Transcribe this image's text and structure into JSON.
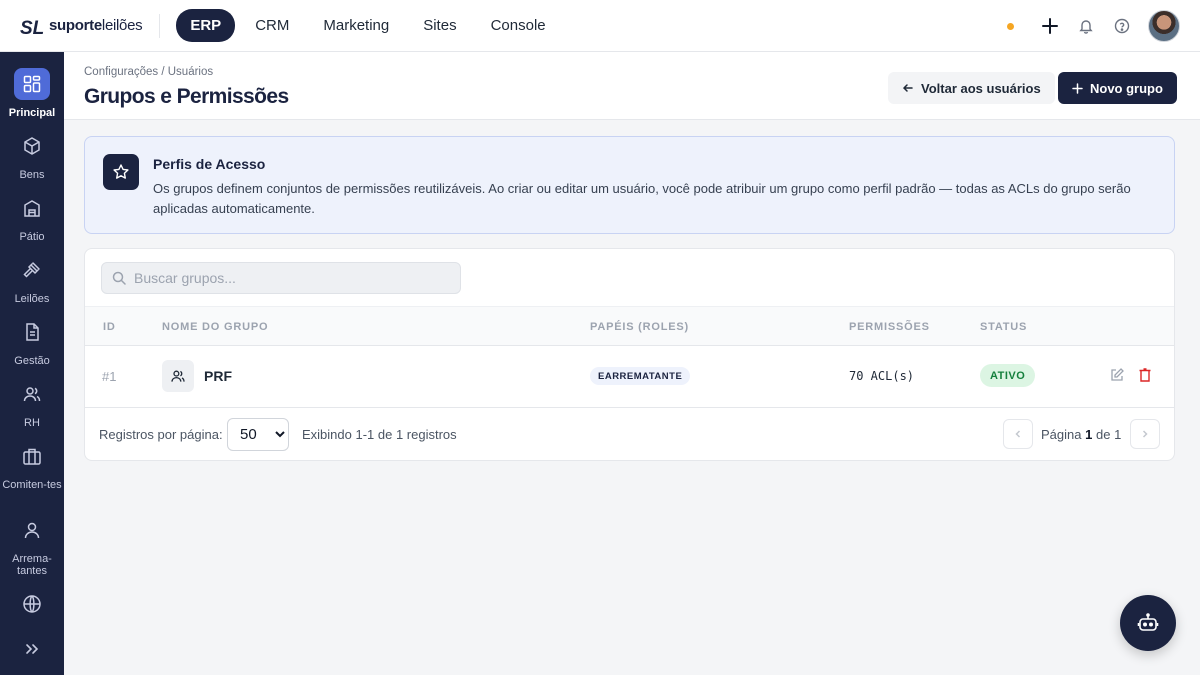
{
  "brand": {
    "name_bold": "suporte",
    "name_light": "leilões"
  },
  "topnav": {
    "items": [
      "ERP",
      "CRM",
      "Marketing",
      "Sites",
      "Console"
    ],
    "active": "ERP"
  },
  "topbar_icons": [
    "status-dot",
    "plus-icon",
    "bell-icon",
    "help-icon",
    "avatar"
  ],
  "sidebar": {
    "items": [
      {
        "label": "Principal",
        "icon": "dashboard-icon",
        "active": true
      },
      {
        "label": "Bens",
        "icon": "box-icon"
      },
      {
        "label": "Pátio",
        "icon": "warehouse-icon"
      },
      {
        "label": "Leilões",
        "icon": "gavel-icon"
      },
      {
        "label": "Gestão",
        "icon": "document-icon"
      },
      {
        "label": "RH",
        "icon": "users-icon"
      },
      {
        "label": "Comiten-tes",
        "icon": "briefcase-icon"
      },
      {
        "label": "Arrema-tantes",
        "icon": "user-icon"
      },
      {
        "label": "",
        "icon": "globe-icon"
      }
    ]
  },
  "header": {
    "breadcrumb": "Configurações / Usuários",
    "title": "Grupos e Permissões",
    "back_label": "Voltar aos usuários",
    "new_label": "Novo grupo"
  },
  "info": {
    "title": "Perfis de Acesso",
    "text": "Os grupos definem conjuntos de permissões reutilizáveis. Ao criar ou editar um usuário, você pode atribuir um grupo como perfil padrão — todas as ACLs do grupo serão aplicadas automaticamente."
  },
  "search": {
    "placeholder": "Buscar grupos..."
  },
  "table": {
    "headers": {
      "id": "ID",
      "name": "NOME DO GRUPO",
      "roles": "PAPÉIS (ROLES)",
      "perms": "PERMISSÕES",
      "status": "STATUS"
    },
    "rows": [
      {
        "id": "#1",
        "name": "PRF",
        "role": "EARREMATANTE",
        "perms": "70 ACL(s)",
        "status": "ATIVO"
      }
    ]
  },
  "footer": {
    "per_page_label": "Registros por página:",
    "per_page_value": "50",
    "showing": "Exibindo 1-1 de 1 registros",
    "page_prefix": "Página",
    "page_current": "1",
    "page_sep": "de",
    "page_total": "1"
  },
  "colors": {
    "navy": "#1b2340",
    "accent": "#4f6bd8",
    "status_dot": "#f5a623",
    "active_green": "#15803d",
    "danger": "#dc2626"
  }
}
